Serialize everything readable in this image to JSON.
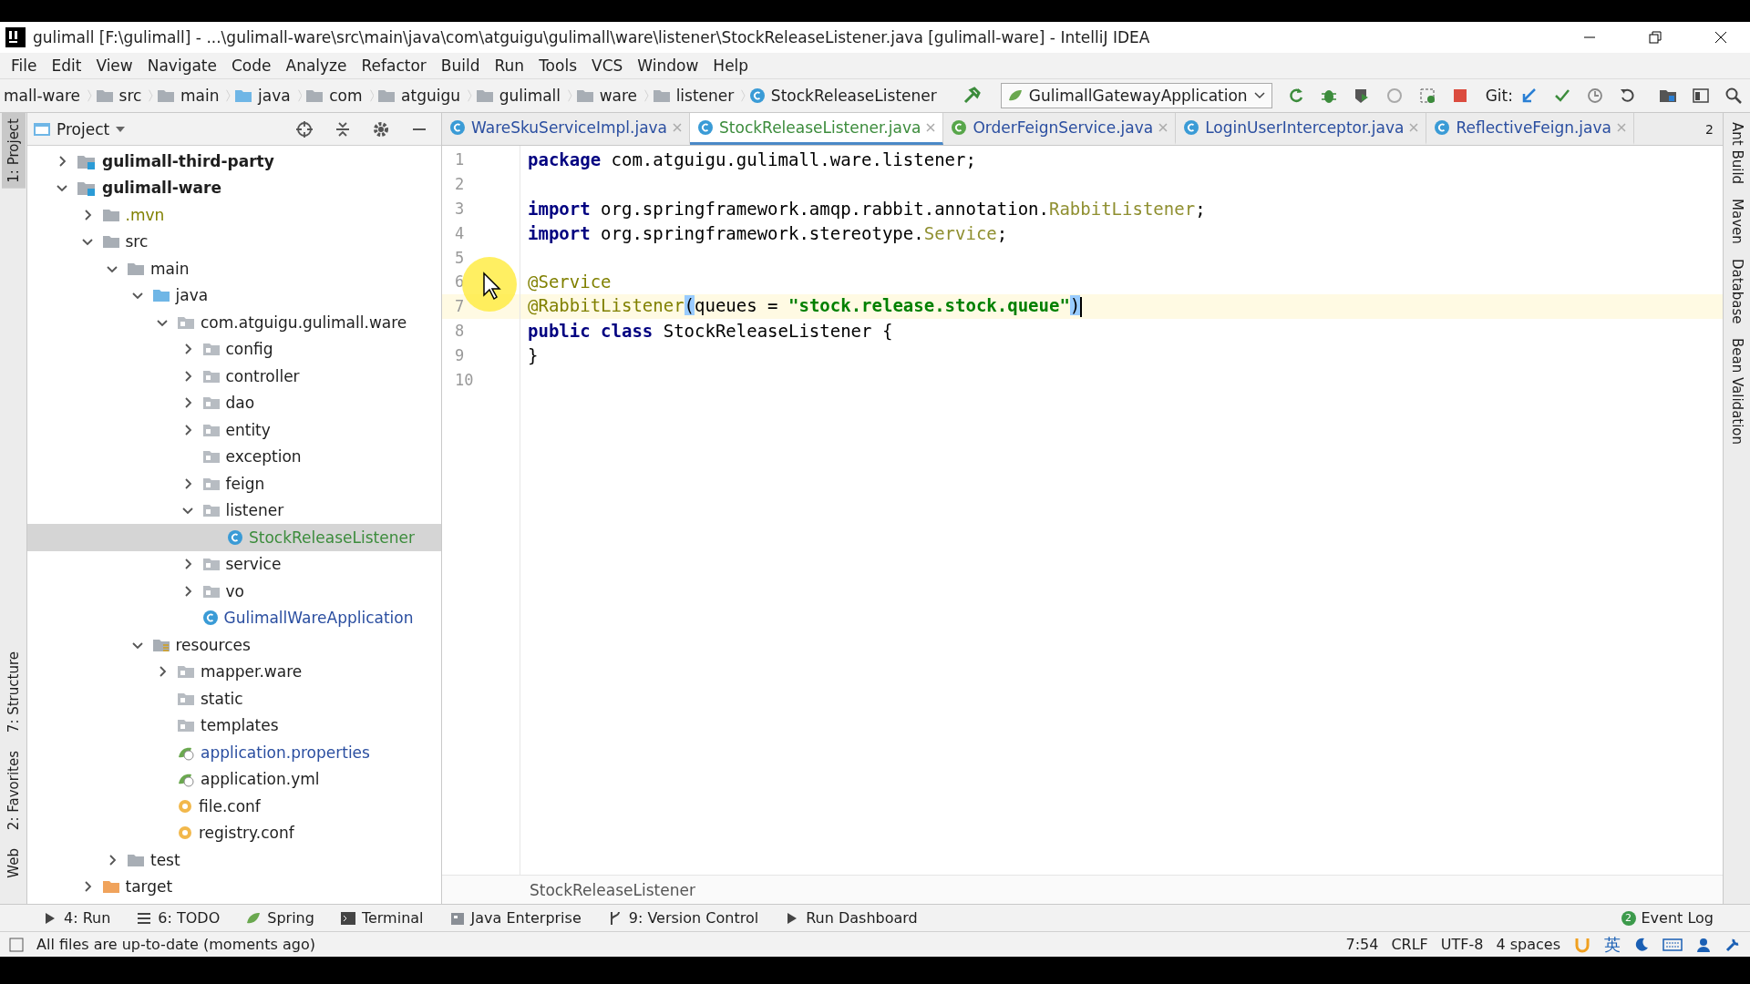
{
  "window": {
    "title": "gulimall [F:\\gulimall] - ...\\gulimall-ware\\src\\main\\java\\com\\atguigu\\gulimall\\ware\\listener\\StockReleaseListener.java [gulimall-ware] - IntelliJ IDEA"
  },
  "menu": [
    "File",
    "Edit",
    "View",
    "Navigate",
    "Code",
    "Analyze",
    "Refactor",
    "Build",
    "Run",
    "Tools",
    "VCS",
    "Window",
    "Help"
  ],
  "breadcrumbs": [
    {
      "label": "mall-ware",
      "kind": "module"
    },
    {
      "label": "src",
      "kind": "folder"
    },
    {
      "label": "main",
      "kind": "folder"
    },
    {
      "label": "java",
      "kind": "source"
    },
    {
      "label": "com",
      "kind": "folder"
    },
    {
      "label": "atguigu",
      "kind": "folder"
    },
    {
      "label": "gulimall",
      "kind": "folder"
    },
    {
      "label": "ware",
      "kind": "folder"
    },
    {
      "label": "listener",
      "kind": "folder"
    },
    {
      "label": "StockReleaseListener",
      "kind": "class"
    }
  ],
  "run_config": "GulimallGatewayApplication",
  "git_label": "Git:",
  "project_panel": {
    "title": "Project",
    "tree": [
      {
        "label": "gulimall-third-party",
        "kind": "module",
        "expanded": false,
        "selected": false
      },
      {
        "label": "gulimall-ware",
        "kind": "module",
        "expanded": true,
        "selected": false,
        "children": [
          {
            "label": ".mvn",
            "kind": "folder",
            "expanded": false,
            "selected": false,
            "color": "#808000"
          },
          {
            "label": "src",
            "kind": "folder",
            "expanded": true,
            "selected": false,
            "children": [
              {
                "label": "main",
                "kind": "folder",
                "expanded": true,
                "selected": false,
                "children": [
                  {
                    "label": "java",
                    "kind": "source",
                    "expanded": true,
                    "selected": false,
                    "children": [
                      {
                        "label": "com.atguigu.gulimall.ware",
                        "kind": "package",
                        "expanded": true,
                        "selected": false,
                        "children": [
                          {
                            "label": "config",
                            "kind": "package",
                            "expanded": false,
                            "selected": false
                          },
                          {
                            "label": "controller",
                            "kind": "package",
                            "expanded": false,
                            "selected": false
                          },
                          {
                            "label": "dao",
                            "kind": "package",
                            "expanded": false,
                            "selected": false
                          },
                          {
                            "label": "entity",
                            "kind": "package",
                            "expanded": false,
                            "selected": false
                          },
                          {
                            "label": "exception",
                            "kind": "package",
                            "selected": false
                          },
                          {
                            "label": "feign",
                            "kind": "package",
                            "expanded": false,
                            "selected": false
                          },
                          {
                            "label": "listener",
                            "kind": "package",
                            "expanded": true,
                            "selected": false,
                            "children": [
                              {
                                "label": "StockReleaseListener",
                                "kind": "class",
                                "selected": true,
                                "color": "#3c8c3c"
                              }
                            ]
                          },
                          {
                            "label": "service",
                            "kind": "package",
                            "expanded": false,
                            "selected": false
                          },
                          {
                            "label": "vo",
                            "kind": "package",
                            "expanded": false,
                            "selected": false
                          },
                          {
                            "label": "GulimallWareApplication",
                            "kind": "app",
                            "selected": false,
                            "color": "#2a4ea0"
                          }
                        ]
                      }
                    ]
                  },
                  {
                    "label": "resources",
                    "kind": "resources",
                    "expanded": true,
                    "selected": false,
                    "children": [
                      {
                        "label": "mapper.ware",
                        "kind": "package",
                        "expanded": false,
                        "selected": false
                      },
                      {
                        "label": "static",
                        "kind": "package",
                        "selected": false
                      },
                      {
                        "label": "templates",
                        "kind": "package",
                        "selected": false
                      },
                      {
                        "label": "application.properties",
                        "kind": "spring",
                        "selected": false,
                        "color": "#2a4ea0"
                      },
                      {
                        "label": "application.yml",
                        "kind": "spring",
                        "selected": false
                      },
                      {
                        "label": "file.conf",
                        "kind": "config",
                        "selected": false
                      },
                      {
                        "label": "registry.conf",
                        "kind": "config",
                        "selected": false
                      }
                    ]
                  }
                ]
              },
              {
                "label": "test",
                "kind": "folder",
                "expanded": false,
                "selected": false
              }
            ]
          },
          {
            "label": "target",
            "kind": "excluded",
            "expanded": false,
            "selected": false
          }
        ]
      }
    ]
  },
  "tabs": [
    {
      "label": "WareSkuServiceImpl.java",
      "kind": "class",
      "selected": false
    },
    {
      "label": "StockReleaseListener.java",
      "kind": "class",
      "selected": true
    },
    {
      "label": "OrderFeignService.java",
      "kind": "interface",
      "selected": false
    },
    {
      "label": "LoginUserInterceptor.java",
      "kind": "class",
      "selected": false
    },
    {
      "label": "ReflectiveFeign.java",
      "kind": "class",
      "selected": false
    }
  ],
  "tab_overflow": "2",
  "code": [
    {
      "number": "1",
      "current": false,
      "tokens": [
        {
          "kind": "kw",
          "t": "package"
        },
        {
          "kind": "plain",
          "t": " com.atguigu.gulimall.ware.listener;"
        }
      ]
    },
    {
      "number": "2",
      "current": false
    },
    {
      "number": "3",
      "current": false,
      "tokens": [
        {
          "kind": "kw",
          "t": "import"
        },
        {
          "kind": "plain",
          "t": " org.springframework.amqp.rabbit.annotation."
        },
        {
          "kind": "type",
          "t": "RabbitListener"
        },
        {
          "kind": "plain",
          "t": ";"
        }
      ]
    },
    {
      "number": "4",
      "current": false,
      "tokens": [
        {
          "kind": "kw",
          "t": "import"
        },
        {
          "kind": "plain",
          "t": " org.springframework.stereotype."
        },
        {
          "kind": "type",
          "t": "Service"
        },
        {
          "kind": "plain",
          "t": ";"
        }
      ]
    },
    {
      "number": "5",
      "current": false
    },
    {
      "number": "6",
      "current": false,
      "tokens": [
        {
          "kind": "anno",
          "t": "@Service"
        }
      ]
    },
    {
      "number": "7",
      "current": true,
      "tokens": [
        {
          "kind": "anno",
          "t": "@RabbitListener"
        },
        {
          "kind": "brace",
          "t": "("
        },
        {
          "kind": "plain",
          "t": "queues = "
        },
        {
          "kind": "str",
          "t": "\"stock.release.stock.queue\""
        },
        {
          "kind": "brace",
          "t": ")"
        }
      ]
    },
    {
      "number": "8",
      "current": false,
      "tokens": [
        {
          "kind": "kw",
          "t": "public class"
        },
        {
          "kind": "plain",
          "t": " StockReleaseListener {"
        }
      ]
    },
    {
      "number": "9",
      "current": false,
      "tokens": [
        {
          "kind": "plain",
          "t": "}"
        }
      ]
    },
    {
      "number": "10",
      "current": false
    }
  ],
  "editor_breadcrumb": "StockReleaseListener",
  "left_stripe": [
    {
      "label": "1: Project",
      "selected": true
    },
    {
      "label": "7: Structure",
      "selected": false
    },
    {
      "label": "2: Favorites",
      "selected": false
    },
    {
      "label": "Web",
      "selected": false
    }
  ],
  "right_stripe": [
    "Ant Build",
    "Maven",
    "Database",
    "Bean Validation"
  ],
  "tool_tabs": [
    {
      "label": "4: Run",
      "kind": "run"
    },
    {
      "label": "6: TODO",
      "kind": "todo"
    },
    {
      "label": "Spring",
      "kind": "spring"
    },
    {
      "label": "Terminal",
      "kind": "terminal"
    },
    {
      "label": "Java Enterprise",
      "kind": "enterprise"
    },
    {
      "label": "9: Version Control",
      "kind": "vcs"
    },
    {
      "label": "Run Dashboard",
      "kind": "run"
    }
  ],
  "event_log": {
    "label": "Event Log",
    "count": "2"
  },
  "status_bar": {
    "message": "All files are up-to-date (moments ago)",
    "position": "7:54",
    "line_ending": "CRLF",
    "encoding": "UTF-8",
    "indent": "4 spaces",
    "ime": "英"
  }
}
